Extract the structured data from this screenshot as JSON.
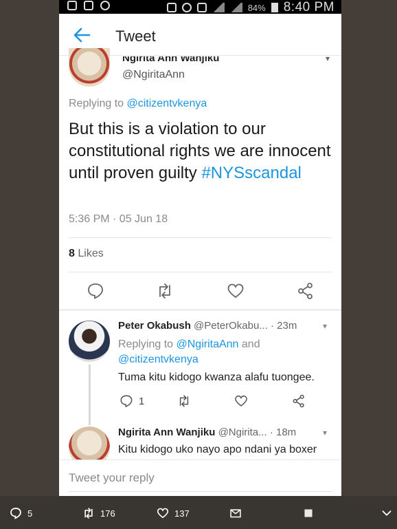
{
  "status_bar": {
    "battery": "84%",
    "time": "8:40 PM"
  },
  "app_bar": {
    "title": "Tweet"
  },
  "tweet": {
    "author_name": "Ngirita Ann Wanjiku",
    "handle": "@NgiritaAnn",
    "replying_prefix": "Replying to",
    "replying_to": "@citizentvkenya",
    "text_main": "But this is a violation to our constitutional rights we are innocent until proven guilty",
    "hashtag": "#NYSscandal",
    "timestamp": "5:36 PM · 05 Jun 18",
    "likes_count": "8",
    "likes_label": "Likes"
  },
  "replies": [
    {
      "name": "Peter Okabush",
      "handle": "@PeterOkabu...",
      "time": "· 23m",
      "replying_prefix": "Replying to",
      "replying_to_1": "@NgiritaAnn",
      "replying_and": "and",
      "replying_to_2": "@citizentvkenya",
      "text": "Tuma kitu kidogo kwanza alafu tuongee.",
      "reply_count": "1"
    },
    {
      "name": "Ngirita Ann Wanjiku",
      "handle": "@Ngirita...",
      "time": "· 18m",
      "text": "Kitu kidogo uko nayo apo ndani ya boxer"
    }
  ],
  "composer": {
    "placeholder": "Tweet your reply"
  },
  "outer_actions": {
    "replies": "5",
    "retweets": "176",
    "likes": "137"
  },
  "colors": {
    "accent": "#1b95e0",
    "page_bg": "#453e38",
    "bar_bg": "#393632"
  }
}
